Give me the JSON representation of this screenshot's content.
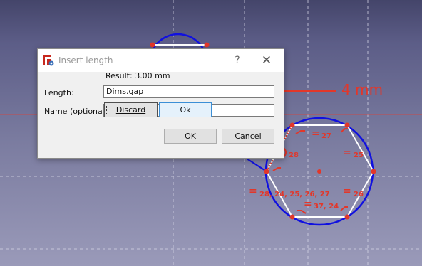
{
  "dialog": {
    "title": "Insert length",
    "help_label": "?",
    "close_label": "✕",
    "result_text": "Result:  3.00 mm",
    "length_label": "Length:",
    "length_value": "Dims.gap",
    "name_label": "Name (optional)",
    "name_value": "",
    "discard_label": "Discard",
    "popup_ok_label": "Ok",
    "ok_label": "OK",
    "cancel_label": "Cancel"
  },
  "sketch": {
    "dimension_label": "4 mm",
    "constraint_labels": {
      "top_equal": "27",
      "right_upper_equal": "25",
      "left_angle": "28",
      "left_equal_list": "28, 24, 25, 26, 27",
      "right_lower_equal": "26",
      "bottom_equal_list": "37, 24",
      "equal_sign": "="
    },
    "colors": {
      "constraint_red": "#e2372a",
      "circle_blue": "#1010e0",
      "geometry_white": "#ffffff",
      "axis_red": "#c84a4a"
    }
  }
}
